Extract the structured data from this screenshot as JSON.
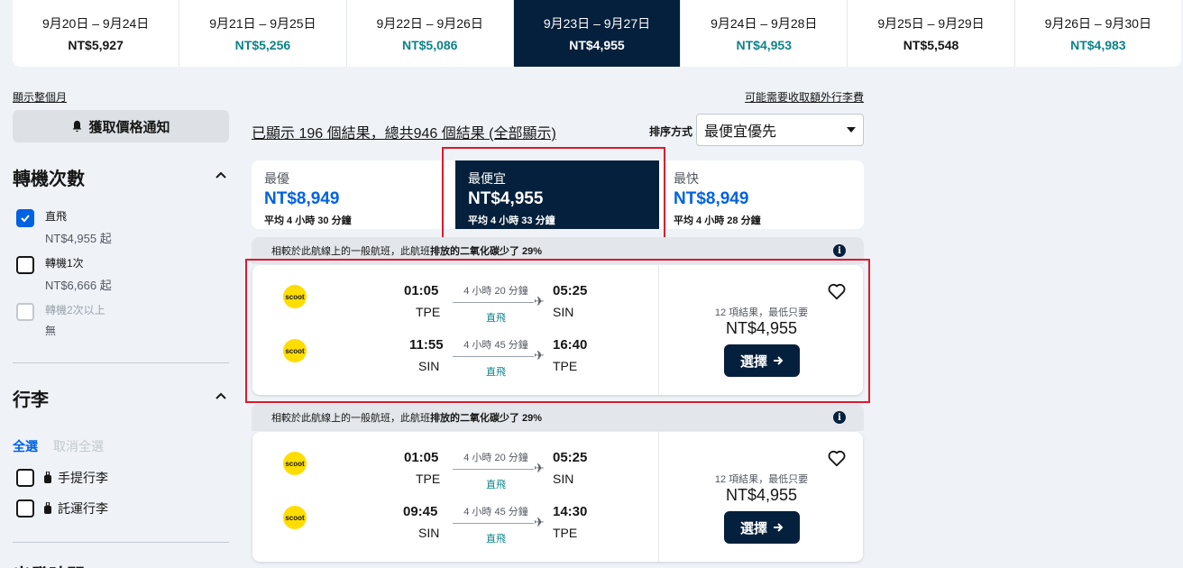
{
  "date_strip": [
    {
      "range": "9月20日 – 9月24日",
      "price": "NT$5,927",
      "style": "dark",
      "active": false
    },
    {
      "range": "9月21日 – 9月25日",
      "price": "NT$5,256",
      "style": "teal",
      "active": false
    },
    {
      "range": "9月22日 – 9月26日",
      "price": "NT$5,086",
      "style": "teal",
      "active": false
    },
    {
      "range": "9月23日 – 9月27日",
      "price": "NT$4,955",
      "style": "dark",
      "active": true
    },
    {
      "range": "9月24日 – 9月28日",
      "price": "NT$4,953",
      "style": "teal",
      "active": false
    },
    {
      "range": "9月25日 – 9月29日",
      "price": "NT$5,548",
      "style": "dark",
      "active": false
    },
    {
      "range": "9月26日 – 9月30日",
      "price": "NT$4,983",
      "style": "teal",
      "active": false
    }
  ],
  "links": {
    "show_month": "顯示整個月",
    "baggage_fee": "可能需要收取額外行李費"
  },
  "sidebar": {
    "alert_label": "獲取價格通知",
    "stops_title": "轉機次數",
    "stops": [
      {
        "label": "直飛",
        "sub": "NT$4,955 起",
        "checked": true,
        "disabled": false
      },
      {
        "label": "轉機1次",
        "sub": "NT$6,666 起",
        "checked": false,
        "disabled": false
      },
      {
        "label": "轉機2次以上",
        "sub": "無",
        "checked": false,
        "disabled": true
      }
    ],
    "baggage_title": "行李",
    "select_all": "全選",
    "clear_all": "取消全選",
    "bags": [
      {
        "label": "手提行李"
      },
      {
        "label": "託運行李"
      }
    ],
    "next_title": "出發時間"
  },
  "results": {
    "count_text": "已顯示 196 個結果，總共946 個結果 (全部顯示)",
    "sort_label": "排序方式",
    "sort_value": "最便宜優先"
  },
  "tabs": [
    {
      "name": "最優",
      "price": "NT$8,949",
      "avg": "平均 4 小時 30 分鐘",
      "active": false
    },
    {
      "name": "最便宜",
      "price": "NT$4,955",
      "avg": "平均 4 小時 33 分鐘",
      "active": true
    },
    {
      "name": "最快",
      "price": "NT$8,949",
      "avg": "平均 4 小時 28 分鐘",
      "active": false
    }
  ],
  "eco_banner": {
    "pre": "相較於此航線上的一般航班，此航班",
    "bold": "排放的二氧化碳少了 29%"
  },
  "cards": [
    {
      "legs": [
        {
          "airline": "scoot",
          "dep": "01:05",
          "dep_code": "TPE",
          "dur": "4 小時 20 分鐘",
          "stops": "直飛",
          "arr": "05:25",
          "arr_code": "SIN"
        },
        {
          "airline": "scoot",
          "dep": "11:55",
          "dep_code": "SIN",
          "dur": "4 小時 45 分鐘",
          "stops": "直飛",
          "arr": "16:40",
          "arr_code": "TPE"
        }
      ],
      "deals": "12 項結果，最低只要",
      "price": "NT$4,955",
      "button": "選擇"
    },
    {
      "legs": [
        {
          "airline": "scoot",
          "dep": "01:05",
          "dep_code": "TPE",
          "dur": "4 小時 20 分鐘",
          "stops": "直飛",
          "arr": "05:25",
          "arr_code": "SIN"
        },
        {
          "airline": "scoot",
          "dep": "09:45",
          "dep_code": "SIN",
          "dur": "4 小時 45 分鐘",
          "stops": "直飛",
          "arr": "14:30",
          "arr_code": "TPE"
        }
      ],
      "deals": "12 項結果，最低只要",
      "price": "NT$4,955",
      "button": "選擇"
    }
  ],
  "colors": {
    "navy": "#05203c",
    "teal": "#0c838a",
    "blue": "#0062e3",
    "highlight": "#e0182d",
    "scoot_yellow": "#ffdd00"
  },
  "icons": [
    "bell-icon",
    "chevron-up-icon",
    "check-icon",
    "luggage-icon",
    "caret-down-icon",
    "info-icon",
    "airline-logo",
    "plane-icon",
    "heart-icon",
    "arrow-right-icon"
  ]
}
